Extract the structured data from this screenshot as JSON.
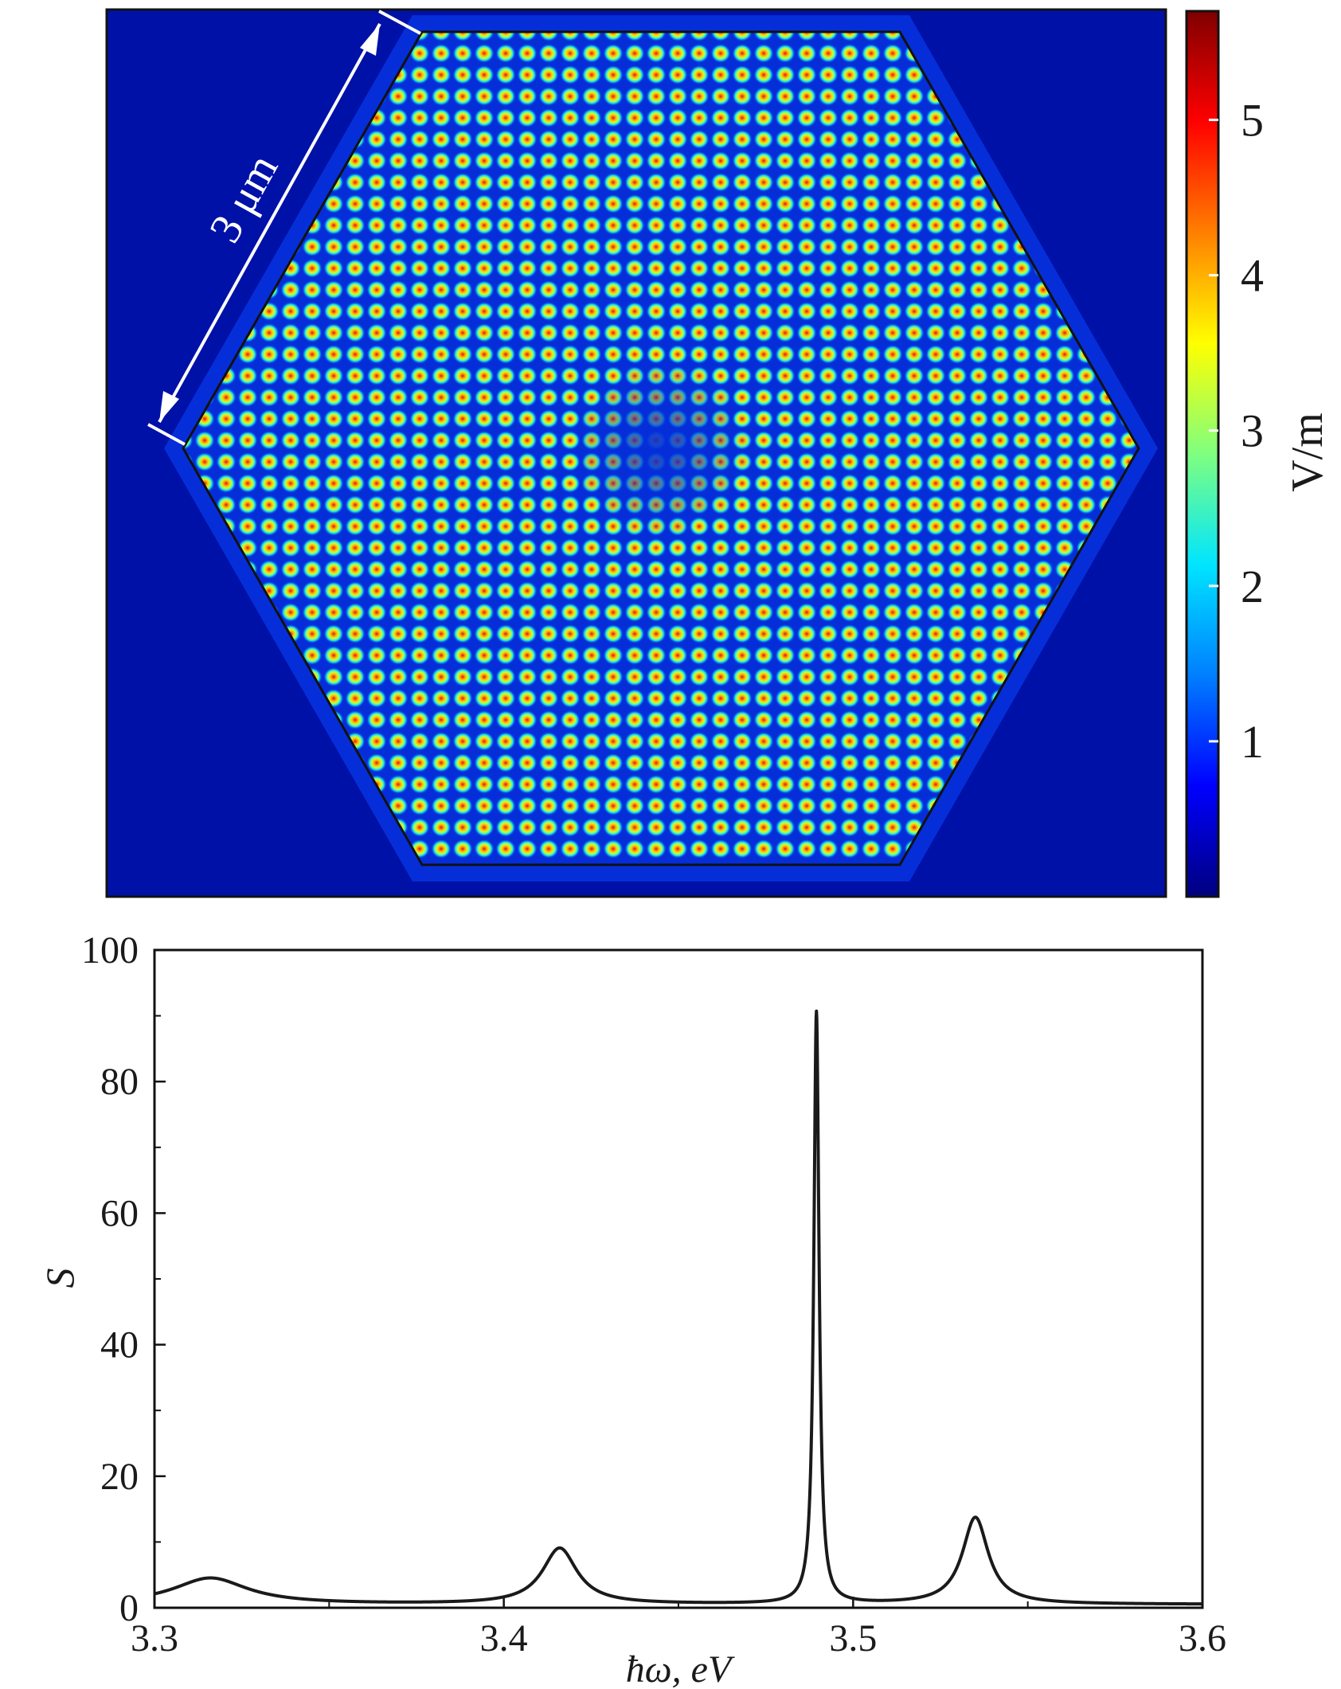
{
  "chart_data": [
    {
      "type": "heatmap",
      "title": "",
      "annotation": "3 μm",
      "colorbar": {
        "label": "V/m",
        "range": [
          0,
          5.7
        ],
        "ticks": [
          1,
          2,
          3,
          4,
          5
        ],
        "tick_labels": [
          "1",
          "2",
          "3",
          "4",
          "5"
        ],
        "colormap": [
          "#00007f",
          "#0000ff",
          "#007fff",
          "#00e5ff",
          "#7fff7f",
          "#ffff00",
          "#ff7f00",
          "#ff0000",
          "#7f0000"
        ]
      },
      "shape": "hexagon",
      "background_color": "#0011a8"
    },
    {
      "type": "line",
      "title": "",
      "xlabel": "ħω, eV",
      "ylabel": "S",
      "xlim": [
        3.3,
        3.6
      ],
      "ylim": [
        0,
        100
      ],
      "x_ticks": [
        3.3,
        3.4,
        3.5,
        3.6
      ],
      "x_tick_labels": [
        "3.3",
        "3.4",
        "3.5",
        "3.6"
      ],
      "y_ticks": [
        0,
        20,
        40,
        60,
        80,
        100
      ],
      "y_tick_labels": [
        "0",
        "20",
        "40",
        "60",
        "80",
        "100"
      ],
      "grid": false,
      "series": [
        {
          "color": "#1a1a1a",
          "baseline": 0.5,
          "peaks": [
            {
              "center": 3.316,
              "height": 4.0,
              "width": 0.013
            },
            {
              "center": 3.416,
              "height": 8.5,
              "width": 0.006
            },
            {
              "center": 3.4895,
              "height": 90.0,
              "width": 0.0009
            },
            {
              "center": 3.535,
              "height": 13.2,
              "width": 0.0045
            }
          ],
          "x": [
            3.3,
            3.31,
            3.316,
            3.33,
            3.36,
            3.39,
            3.405,
            3.416,
            3.43,
            3.46,
            3.48,
            3.487,
            3.4895,
            3.492,
            3.5,
            3.52,
            3.535,
            3.55,
            3.58,
            3.6
          ],
          "y": [
            1.4,
            3.8,
            4.3,
            3.0,
            0.9,
            1.1,
            3.5,
            9.0,
            3.0,
            1.2,
            1.6,
            8.0,
            90.5,
            8.0,
            2.5,
            3.5,
            13.5,
            2.0,
            0.8,
            0.6
          ]
        }
      ]
    }
  ]
}
